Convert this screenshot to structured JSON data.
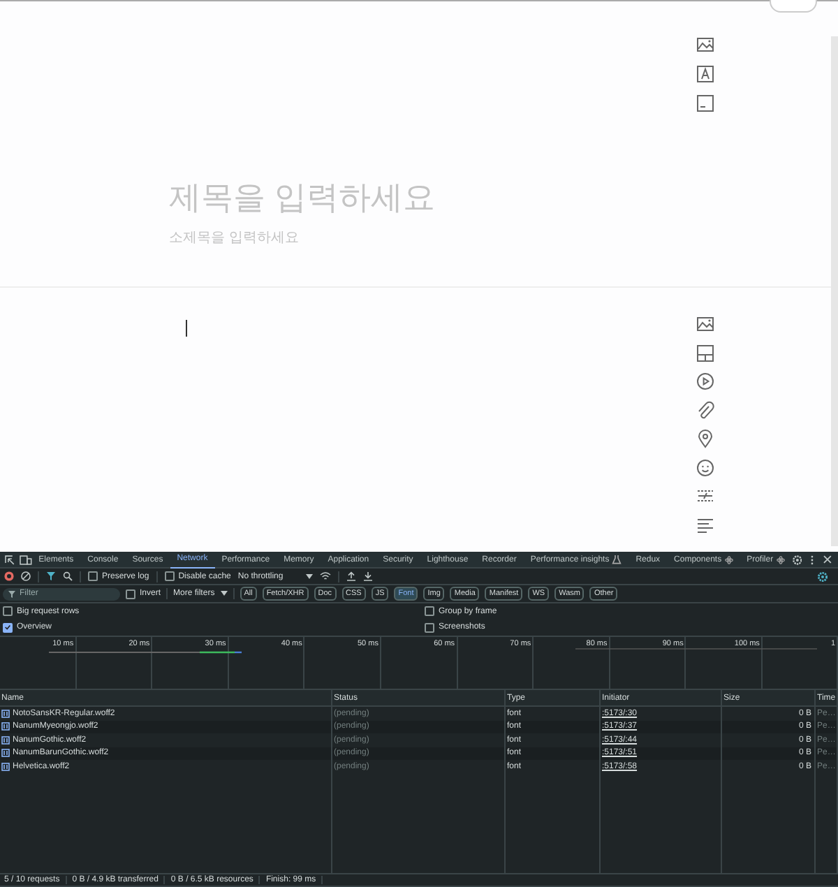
{
  "editor": {
    "title_placeholder": "제목을 입력하세요",
    "subtitle_placeholder": "소제목을 입력하세요"
  },
  "devtools": {
    "tabs": [
      {
        "label": "Elements",
        "selected": false
      },
      {
        "label": "Console",
        "selected": false
      },
      {
        "label": "Sources",
        "selected": false
      },
      {
        "label": "Network",
        "selected": true
      },
      {
        "label": "Performance",
        "selected": false
      },
      {
        "label": "Memory",
        "selected": false
      },
      {
        "label": "Application",
        "selected": false
      },
      {
        "label": "Security",
        "selected": false
      },
      {
        "label": "Lighthouse",
        "selected": false
      },
      {
        "label": "Recorder",
        "selected": false
      },
      {
        "label": "Performance insights",
        "selected": false,
        "kind": "experiment"
      },
      {
        "label": "Redux",
        "selected": false
      },
      {
        "label": "Components",
        "selected": false,
        "kind": "extension"
      },
      {
        "label": "Profiler",
        "selected": false,
        "kind": "extension"
      }
    ],
    "toolbar": {
      "preserve_log": {
        "label": "Preserve log",
        "checked": false
      },
      "disable_cache": {
        "label": "Disable cache",
        "checked": false
      },
      "throttling": "No throttling"
    },
    "filter": {
      "placeholder": "Filter",
      "invert": {
        "label": "Invert",
        "checked": false
      },
      "more_filters": "More filters",
      "types": [
        {
          "label": "All",
          "selected": false
        },
        {
          "label": "Fetch/XHR",
          "selected": false
        },
        {
          "label": "Doc",
          "selected": false
        },
        {
          "label": "CSS",
          "selected": false
        },
        {
          "label": "JS",
          "selected": false
        },
        {
          "label": "Font",
          "selected": true
        },
        {
          "label": "Img",
          "selected": false
        },
        {
          "label": "Media",
          "selected": false
        },
        {
          "label": "Manifest",
          "selected": false
        },
        {
          "label": "WS",
          "selected": false
        },
        {
          "label": "Wasm",
          "selected": false
        },
        {
          "label": "Other",
          "selected": false
        }
      ]
    },
    "options": [
      {
        "label": "Big request rows",
        "checked": false
      },
      {
        "label": "Group by frame",
        "checked": false
      },
      {
        "label": "Overview",
        "checked": true
      },
      {
        "label": "Screenshots",
        "checked": false
      }
    ],
    "overview_ticks": [
      "10 ms",
      "20 ms",
      "30 ms",
      "40 ms",
      "50 ms",
      "60 ms",
      "70 ms",
      "80 ms",
      "90 ms",
      "100 ms",
      "1"
    ],
    "table": {
      "columns": [
        "Name",
        "Status",
        "Type",
        "Initiator",
        "Size",
        "Time"
      ],
      "rows": [
        {
          "name": "NotoSansKR-Regular.woff2",
          "status": "(pending)",
          "type": "font",
          "initiator": ":5173/:30",
          "size": "0 B",
          "time": "Pe…"
        },
        {
          "name": "NanumMyeongjo.woff2",
          "status": "(pending)",
          "type": "font",
          "initiator": ":5173/:37",
          "size": "0 B",
          "time": "Pe…"
        },
        {
          "name": "NanumGothic.woff2",
          "status": "(pending)",
          "type": "font",
          "initiator": ":5173/:44",
          "size": "0 B",
          "time": "Pe…"
        },
        {
          "name": "NanumBarunGothic.woff2",
          "status": "(pending)",
          "type": "font",
          "initiator": ":5173/:51",
          "size": "0 B",
          "time": "Pe…"
        },
        {
          "name": "Helvetica.woff2",
          "status": "(pending)",
          "type": "font",
          "initiator": ":5173/:58",
          "size": "0 B",
          "time": "Pe…"
        }
      ]
    },
    "status_bar": [
      "5 / 10 requests",
      "0 B / 4.9 kB transferred",
      "0 B / 6.5 kB resources",
      "Finish: 99 ms"
    ]
  }
}
